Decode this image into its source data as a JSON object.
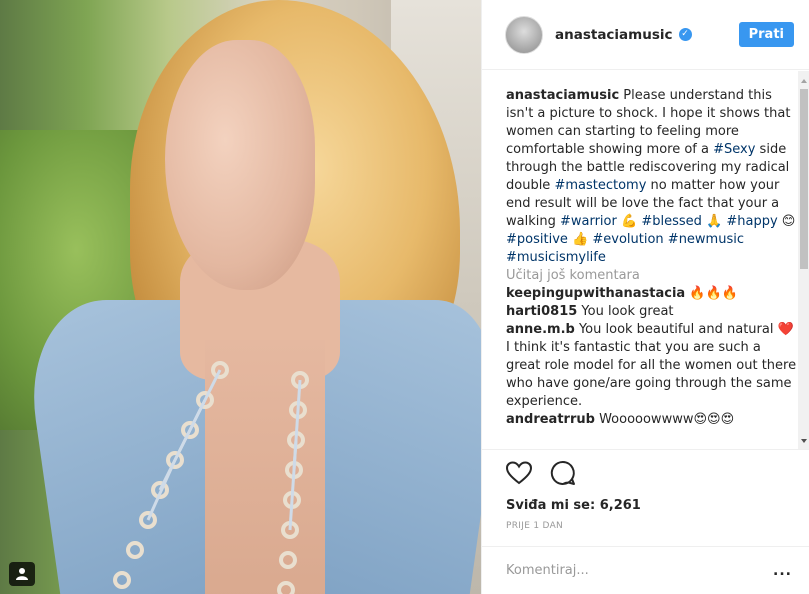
{
  "header": {
    "username": "anastaciamusic",
    "follow_label": "Prati"
  },
  "caption": {
    "username": "anastaciamusic",
    "t1": " Please understand this isn't a picture to shock. I hope it shows that women can starting to feeling more comfortable showing more of a ",
    "tag_sexy": "#Sexy",
    "t2": " side through the battle rediscovering my radical double ",
    "tag_mastectomy": "#mastectomy",
    "t3": " no matter how your end result will be love the fact that your a walking ",
    "tag_warrior": "#warrior",
    "emoji_muscle": "💪",
    "tag_blessed": "#blessed",
    "emoji_pray": "🙏",
    "tag_happy": "#happy",
    "emoji_smile": "😊",
    "tag_positive": "#positive",
    "emoji_thumb": "👍",
    "tag_evolution": "#evolution",
    "tag_newmusic": "#newmusic",
    "tag_musicismylife": "#musicismylife"
  },
  "load_more_label": "Učitaj još komentara",
  "comments": [
    {
      "user": "keepingupwithanastacia",
      "text": " 🔥🔥🔥"
    },
    {
      "user": "harti0815",
      "text": " You look great"
    },
    {
      "user": "anne.m.b",
      "text": " You look beautiful and natural ❤️ I think it's fantastic that you are such a great role model for all the women out there who have gone/are going through the same experience."
    },
    {
      "user": "andreatrrub",
      "text": " Wooooowwww😍😍😍"
    }
  ],
  "likes_text": "Sviđa mi se: 6,261",
  "date_text": "PRIJE 1 DAN",
  "add_comment_placeholder": "Komentiraj...",
  "more_label": "...",
  "icons": {
    "like": "heart-icon",
    "comment": "comment-icon",
    "tagged": "user-tag-icon",
    "verified": "verified-badge-icon",
    "options": "more-options-icon"
  },
  "colors": {
    "accent": "#3897f0",
    "hashtag": "#003569",
    "muted": "#999999"
  }
}
